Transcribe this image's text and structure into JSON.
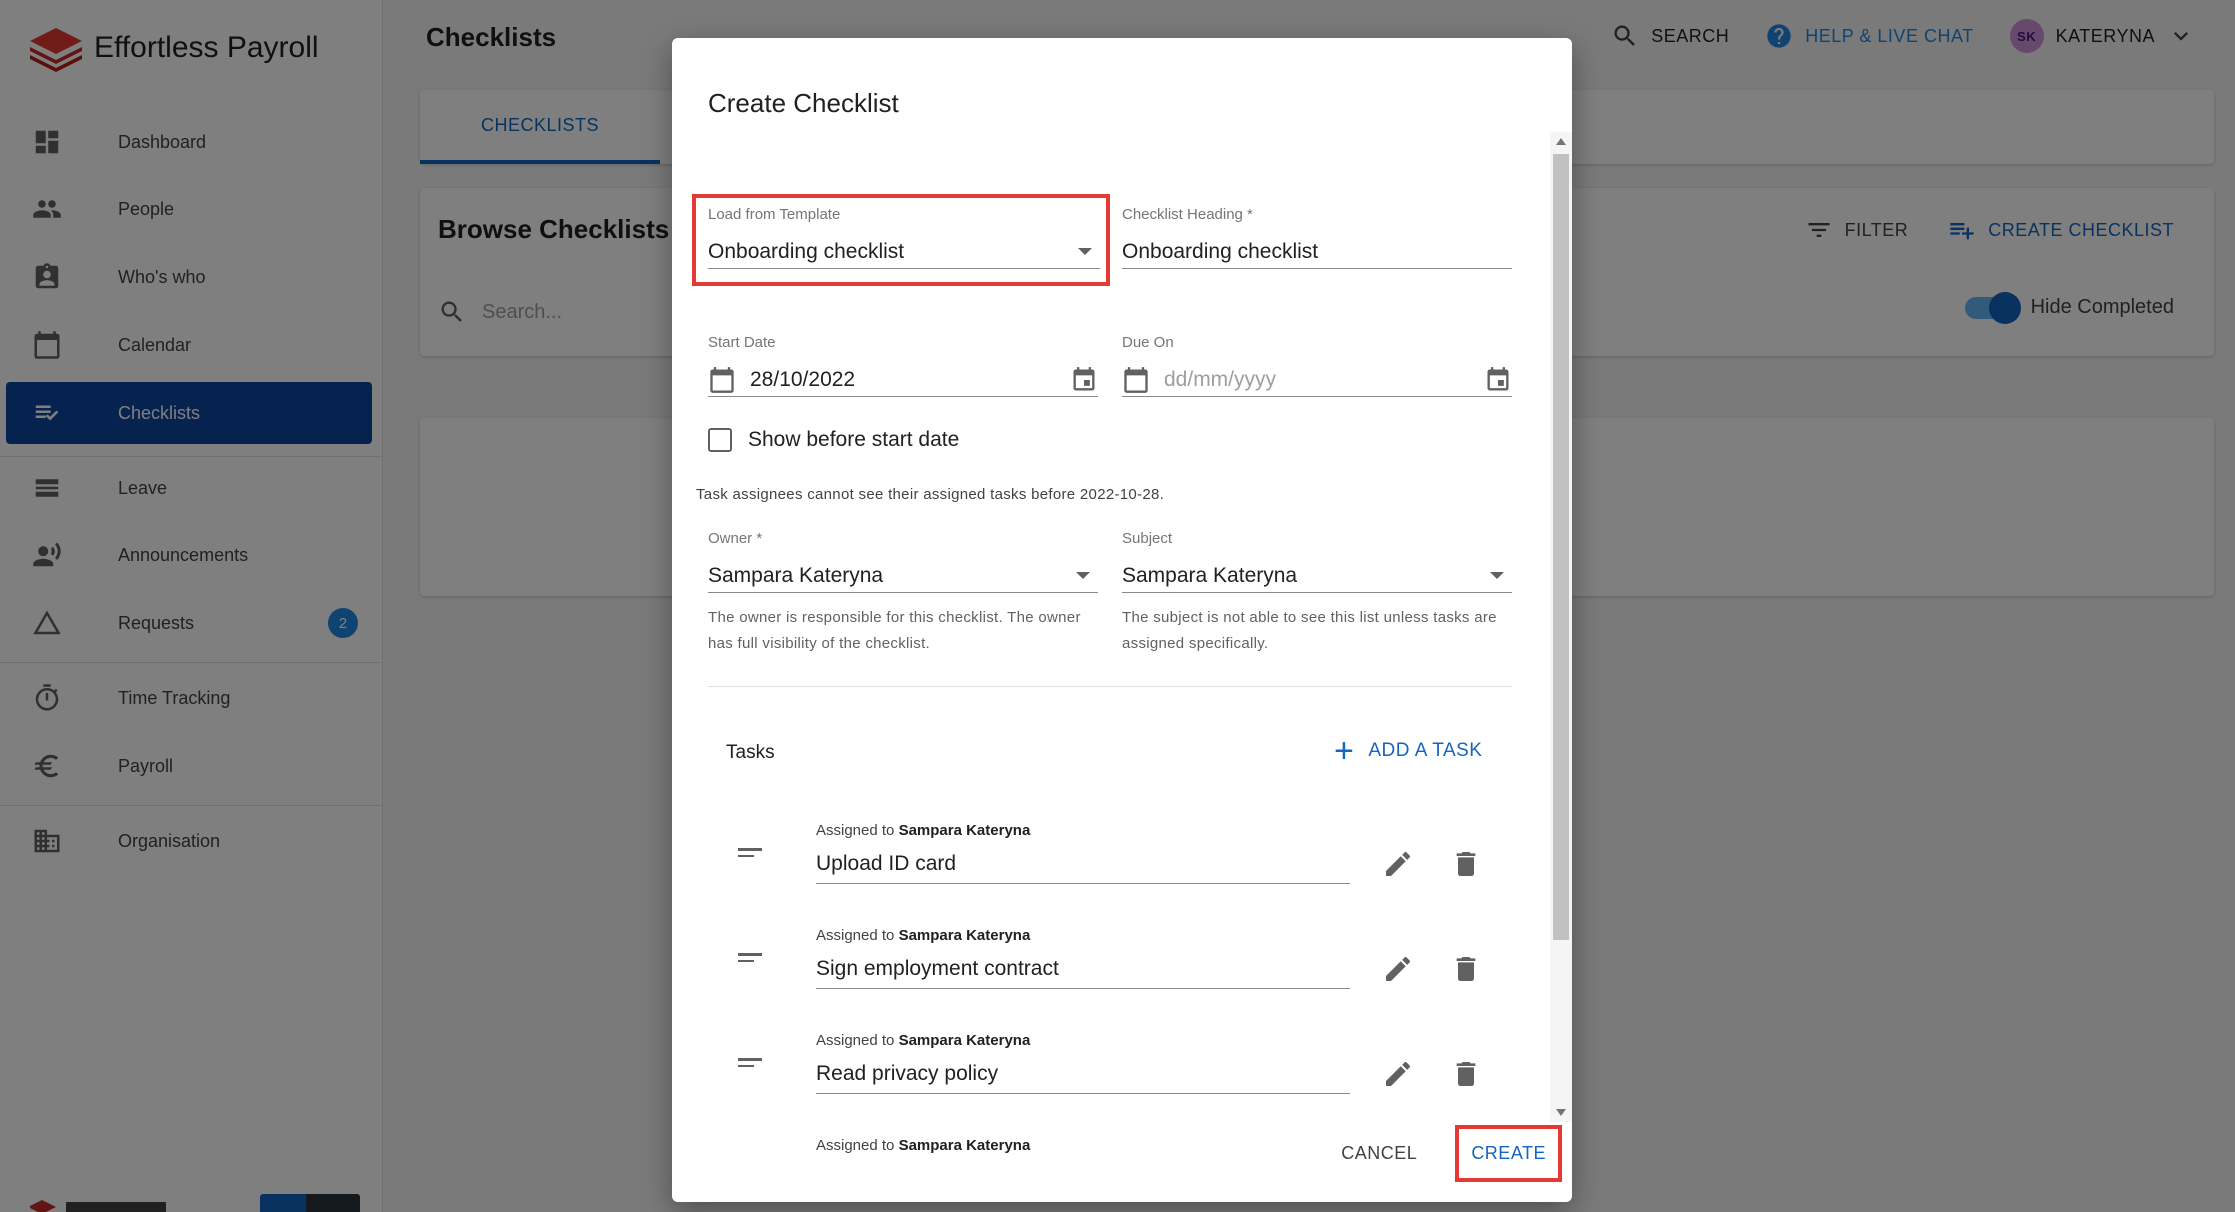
{
  "app": {
    "brand": "Effortless Payroll",
    "page_title": "Checklists"
  },
  "sidebar": {
    "items": [
      {
        "label": "Dashboard",
        "icon": "dashboard-icon"
      },
      {
        "label": "People",
        "icon": "people-icon"
      },
      {
        "label": "Who's who",
        "icon": "contact-card-icon"
      },
      {
        "label": "Calendar",
        "icon": "calendar-icon"
      },
      {
        "label": "Checklists",
        "icon": "checklist-icon",
        "active": true
      },
      {
        "label": "Leave",
        "icon": "leave-icon"
      },
      {
        "label": "Announcements",
        "icon": "announcement-icon"
      },
      {
        "label": "Requests",
        "icon": "warning-triangle-icon",
        "badge": "2"
      },
      {
        "label": "Time Tracking",
        "icon": "timer-icon"
      },
      {
        "label": "Payroll",
        "icon": "euro-icon"
      },
      {
        "label": "Organisation",
        "icon": "building-icon"
      }
    ]
  },
  "topbar": {
    "search": "SEARCH",
    "help": "HELP & LIVE CHAT",
    "avatar_initials": "SK",
    "user": "KATERYNA"
  },
  "main": {
    "tab": "CHECKLISTS",
    "browse_title": "Browse Checklists",
    "filter": "FILTER",
    "create_checklist": "CREATE CHECKLIST",
    "search_placeholder": "Search...",
    "hide_completed": "Hide Completed"
  },
  "dialog": {
    "title": "Create Checklist",
    "template_label": "Load from Template",
    "template_value": "Onboarding checklist",
    "heading_label": "Checklist Heading *",
    "heading_value": "Onboarding checklist",
    "start_label": "Start Date",
    "start_value": "28/10/2022",
    "due_label": "Due On",
    "due_placeholder": "dd/mm/yyyy",
    "show_before": "Show before start date",
    "notice": "Task assignees cannot see their assigned tasks before 2022-10-28.",
    "owner_label": "Owner *",
    "owner_value": "Sampara Kateryna",
    "owner_help": "The owner is responsible for this checklist. The owner has full visibility of the checklist.",
    "subject_label": "Subject",
    "subject_value": "Sampara Kateryna",
    "subject_help": "The subject is not able to see this list unless tasks are assigned specifically.",
    "tasks_heading": "Tasks",
    "add_task": "ADD A TASK",
    "assigned_prefix": "Assigned to",
    "tasks": [
      {
        "assignee": "Sampara Kateryna",
        "name": "Upload ID card"
      },
      {
        "assignee": "Sampara Kateryna",
        "name": "Sign employment contract"
      },
      {
        "assignee": "Sampara Kateryna",
        "name": "Read privacy policy"
      },
      {
        "assignee": "Sampara Kateryna",
        "name": ""
      }
    ],
    "cancel": "CANCEL",
    "create": "CREATE"
  },
  "colors": {
    "primary": "#1565c0",
    "active_nav": "#0d47a1",
    "highlight": "#e53935",
    "help_link": "#1e88e5"
  }
}
